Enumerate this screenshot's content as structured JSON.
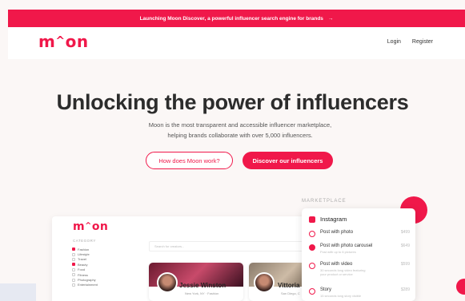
{
  "banner": {
    "text": "Launching Moon Discover, a powerful influencer search engine for brands",
    "arrow": "→"
  },
  "header": {
    "logo": {
      "start": "m",
      "hat": "^",
      "end": "on"
    },
    "login": "Login",
    "register": "Register"
  },
  "hero": {
    "title": "Unlocking the power of influencers",
    "subtitle_line1": "Moon is the most transparent and accessible influencer marketplace,",
    "subtitle_line2": "helping brands collaborate with over 5,000 influencers.",
    "cta_secondary": "How does Moon work?",
    "cta_primary": "Discover our influencers"
  },
  "marketplace": {
    "label": "MARKETPLACE",
    "platform": "Instagram",
    "items": [
      {
        "name": "Post with photo",
        "price": "$499",
        "sub": ""
      },
      {
        "name": "Post with photo carousel",
        "price": "$649",
        "sub": "Post with up to 6 pictures"
      },
      {
        "name": "Post with video",
        "price": "$599",
        "sub1": "30 seconds long video featuring",
        "sub2": "your product or service"
      },
      {
        "name": "Story",
        "price": "$289",
        "sub": "15 seconds long story visible"
      }
    ]
  },
  "preview": {
    "logo": {
      "start": "m",
      "hat": "^",
      "end": "on"
    },
    "category_label": "CATEGORY",
    "categories": [
      "Fashion",
      "Lifestyle",
      "Travel",
      "Beauty",
      "Food",
      "Fitness",
      "Photography",
      "Entertainment"
    ],
    "search_placeholder": "Search for creators...",
    "cards": [
      {
        "name": "Jessie Winston",
        "location": "New York, NY",
        "tag": "Fashion"
      },
      {
        "name": "Vittoria C",
        "location": "San Diego, C"
      }
    ]
  },
  "colors": {
    "brand": "#f0184a",
    "background": "#fbf7f6"
  }
}
